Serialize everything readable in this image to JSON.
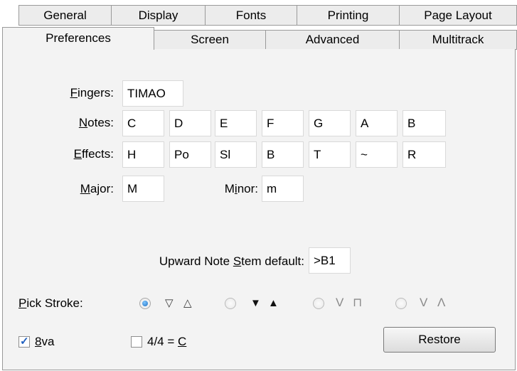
{
  "tabs_row1": [
    "General",
    "Display",
    "Fonts",
    "Printing",
    "Page Layout"
  ],
  "tabs_row2": [
    "Preferences",
    "Screen",
    "Advanced",
    "Multitrack"
  ],
  "active_tab": "Preferences",
  "fingers": {
    "label_pre": "",
    "label_key": "F",
    "label_post": "ingers:",
    "value": "TIMAO"
  },
  "notes": {
    "label_key": "N",
    "label_post": "otes:",
    "values": [
      "C",
      "D",
      "E",
      "F",
      "G",
      "A",
      "B"
    ]
  },
  "effects": {
    "label_key": "E",
    "label_post": "ffects:",
    "values": [
      "H",
      "Po",
      "Sl",
      "B",
      "T",
      "~",
      "R"
    ]
  },
  "major": {
    "label_key": "M",
    "label_post": "ajor:",
    "value": "M"
  },
  "minor": {
    "label_pre": "M",
    "label_key": "i",
    "label_post": "nor:",
    "value": "m"
  },
  "stem": {
    "label_pre": "Upward Note ",
    "label_key": "S",
    "label_post": "tem default:",
    "value": ">B1"
  },
  "pick_stroke": {
    "label_key": "P",
    "label_post": "ick Stroke:",
    "options": [
      {
        "down": "▽",
        "up": "△",
        "selected": true
      },
      {
        "down": "▼",
        "up": "▲",
        "selected": false
      },
      {
        "down": "V",
        "up": "⊓",
        "selected": false
      },
      {
        "down": "V",
        "up": "Λ",
        "selected": false
      }
    ]
  },
  "eightva": {
    "label_key": "8",
    "label_post": "va",
    "checked": true
  },
  "four_four": {
    "label_pre": "4/4 = ",
    "label_key": "C",
    "label_post": "",
    "checked": false
  },
  "restore_label": "Restore",
  "colors": {
    "panel": "#f3f3f3",
    "tab": "#ececec",
    "radio_selected": "#1f6fc0",
    "check": "#2060c0"
  }
}
